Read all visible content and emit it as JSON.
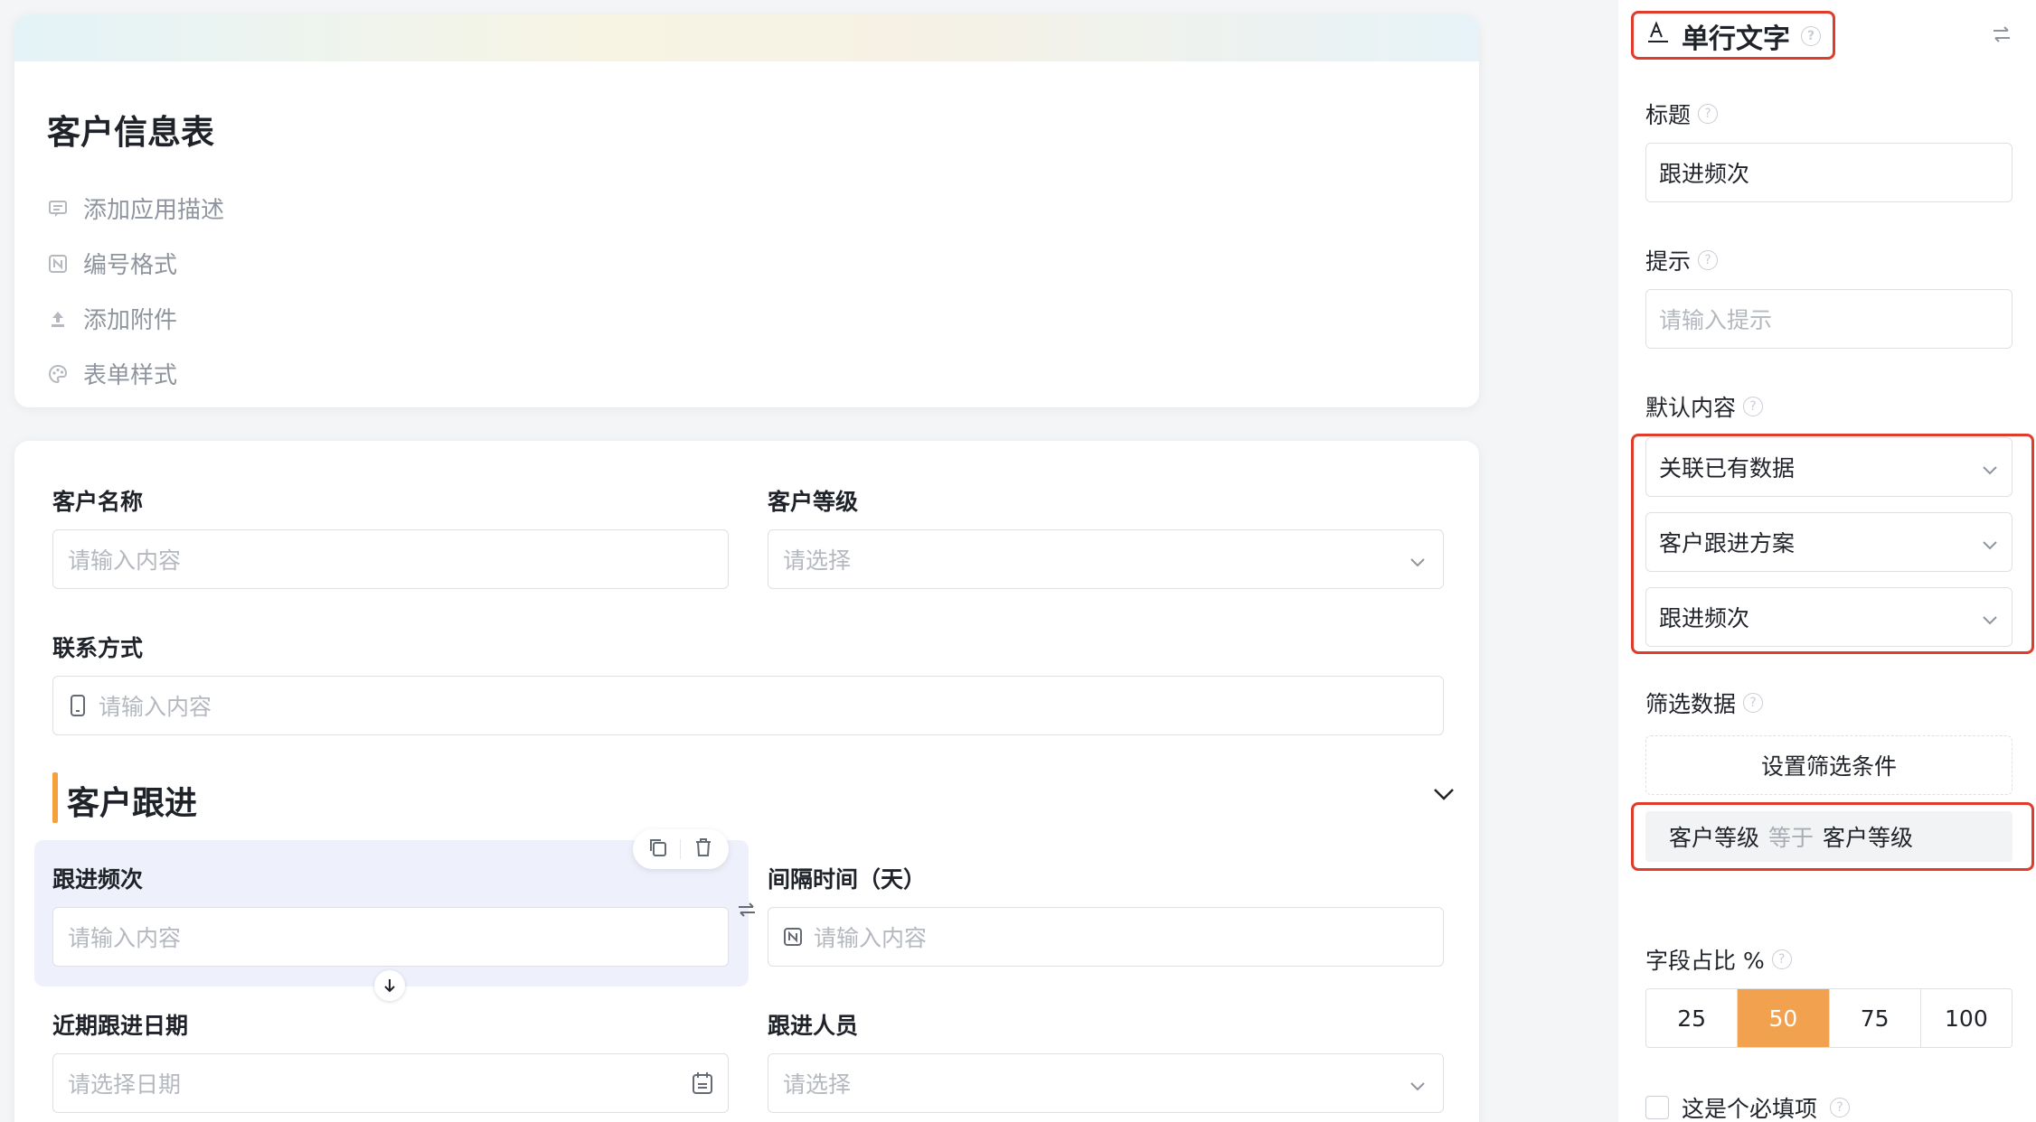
{
  "form": {
    "title": "客户信息表",
    "meta": [
      {
        "label": "添加应用描述",
        "icon": "comment-icon"
      },
      {
        "label": "编号格式",
        "icon": "number-format-icon"
      },
      {
        "label": "添加附件",
        "icon": "upload-icon"
      },
      {
        "label": "表单样式",
        "icon": "palette-icon"
      }
    ]
  },
  "fields": {
    "customer_name": {
      "label": "客户名称",
      "placeholder": "请输入内容"
    },
    "customer_level": {
      "label": "客户等级",
      "placeholder": "请选择"
    },
    "contact": {
      "label": "联系方式",
      "placeholder": "请输入内容"
    },
    "section_title": "客户跟进",
    "follow_freq": {
      "label": "跟进频次",
      "placeholder": "请输入内容"
    },
    "interval": {
      "label": "间隔时间（天）",
      "placeholder": "请输入内容"
    },
    "recent_date": {
      "label": "近期跟进日期",
      "placeholder": "请选择日期"
    },
    "follower": {
      "label": "跟进人员",
      "placeholder": "请选择"
    }
  },
  "panel": {
    "field_type": "单行文字",
    "title_label": "标题",
    "title_value": "跟进频次",
    "hint_label": "提示",
    "hint_placeholder": "请输入提示",
    "default_label": "默认内容",
    "default_mode": "关联已有数据",
    "default_source": "客户跟进方案",
    "default_field": "跟进频次",
    "filter_label": "筛选数据",
    "filter_button": "设置筛选条件",
    "filter_condition": {
      "field": "客户等级",
      "operator": "等于",
      "value": "客户等级"
    },
    "width_label": "字段占比 %",
    "width_options": [
      "25",
      "50",
      "75",
      "100"
    ],
    "width_selected": "50",
    "required_label": "这是个必填项"
  },
  "colors": {
    "accent": "#f2a24e",
    "highlight_border": "#e03c2c",
    "section_bar": "#f5a03b",
    "selected_bg": "#eef1fc"
  }
}
